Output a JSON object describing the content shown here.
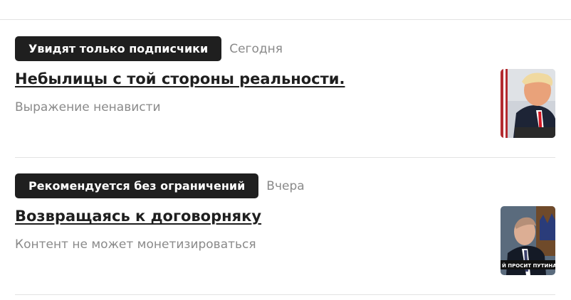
{
  "posts": [
    {
      "badge": "Увидят только подписчики",
      "date": "Сегодня",
      "title": "Небылицы с той стороны реальности.",
      "status": "Выражение ненависти",
      "thumbnail": "person-portrait-thumbnail"
    },
    {
      "badge": "Рекомендуется без ограничений",
      "date": "Вчера",
      "title": "Возвращаясь к договорняку",
      "status": "Контент не может монетизироваться",
      "thumbnail_caption": "Й ПРОСИТ ПУТИНА"
    }
  ]
}
